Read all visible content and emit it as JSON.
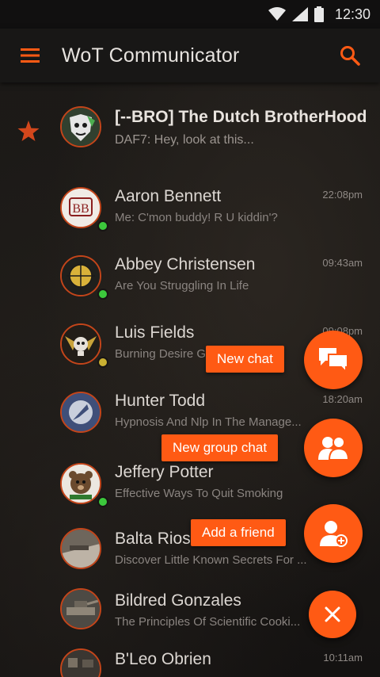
{
  "status_bar": {
    "time": "12:30",
    "icons": [
      "wifi-icon",
      "signal-icon",
      "battery-icon"
    ]
  },
  "app_bar": {
    "title": "WoT Communicator",
    "menu_icon": "hamburger-menu-icon",
    "search_icon": "search-icon"
  },
  "colors": {
    "accent": "#ff5a14",
    "online": "#3cc83c",
    "away": "#c9b032"
  },
  "chats": [
    {
      "name": "[--BRO] The Dutch BrotherHood",
      "message": "DAF7: Hey, look at this...",
      "time": "",
      "starred": true,
      "presence": "none",
      "avatar_icon": "clan-logo-avatar"
    },
    {
      "name": "Aaron Bennett",
      "message": "Me: C'mon buddy! R U kiddin'?",
      "time": "22:08pm",
      "starred": false,
      "presence": "online",
      "avatar_icon": "bb-badge-avatar"
    },
    {
      "name": "Abbey Christensen",
      "message": "Are You Struggling In Life",
      "time": "09:43am",
      "starred": false,
      "presence": "online",
      "avatar_icon": "crosshair-avatar"
    },
    {
      "name": "Luis Fields",
      "message": "Burning Desire Golf Red",
      "time": "09:08pm",
      "starred": false,
      "presence": "away",
      "avatar_icon": "skull-wings-avatar"
    },
    {
      "name": "Hunter Todd",
      "message": "Hypnosis And Nlp In The Manage...",
      "time": "18:20am",
      "starred": false,
      "presence": "none",
      "avatar_icon": "arrow-badge-avatar"
    },
    {
      "name": "Jeffery Potter",
      "message": "Effective Ways To Quit Smoking",
      "time": "",
      "starred": false,
      "presence": "online",
      "avatar_icon": "bear-avatar"
    },
    {
      "name": "Balta Rios",
      "message": "Discover Little Known Secrets For ...",
      "time": "",
      "starred": false,
      "presence": "none",
      "avatar_icon": "tank-photo-avatar"
    },
    {
      "name": "Bildred Gonzales",
      "message": "The Principles Of Scientific Cooki...",
      "time": "",
      "starred": false,
      "presence": "none",
      "avatar_icon": "tank-photo-avatar"
    },
    {
      "name": "B'Leo Obrien",
      "message": "",
      "time": "10:11am",
      "starred": false,
      "presence": "none",
      "avatar_icon": "tank-photo-avatar"
    }
  ],
  "actions": {
    "new_chat": {
      "label": "New chat",
      "icon": "chat-bubbles-icon"
    },
    "new_group_chat": {
      "label": "New group chat",
      "icon": "group-icon"
    },
    "add_friend": {
      "label": "Add a friend",
      "icon": "add-person-icon"
    },
    "close": {
      "icon": "close-icon"
    }
  }
}
